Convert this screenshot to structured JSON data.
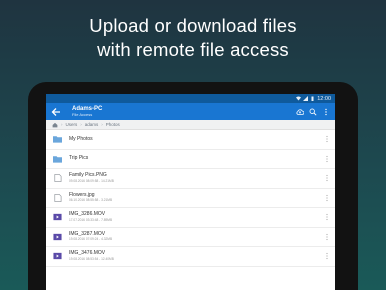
{
  "headline": {
    "line1": "Upload or download files",
    "line2": "with remote file access"
  },
  "status_bar": {
    "time": "12:00"
  },
  "app_bar": {
    "title": "Adams-PC",
    "subtitle": "File Access"
  },
  "breadcrumb": [
    "Users",
    "adams",
    "Photos"
  ],
  "files": [
    {
      "name": "My Photos",
      "meta": "",
      "type": "folder"
    },
    {
      "name": "Trip Pics",
      "meta": "",
      "type": "folder"
    },
    {
      "name": "Family Pics.PNG",
      "meta": "09.08.2016 08:09:58 - 14.21MB",
      "type": "file"
    },
    {
      "name": "Flowers.jpg",
      "meta": "06.10.2016 08:55:58 - 3.21MB",
      "type": "file"
    },
    {
      "name": "IMG_3286.MOV",
      "meta": "17.07.2016 03:33:48 - 7.89MB",
      "type": "video"
    },
    {
      "name": "IMG_3287.MOV",
      "meta": "19.08.2016 07:09:24 - 4.32MB",
      "type": "video"
    },
    {
      "name": "IMG_3476.MOV",
      "meta": "19.08.2016 08:53:54 - 12.40MB",
      "type": "video"
    }
  ],
  "colors": {
    "app_bar": "#1976d2",
    "status_bar": "#0f5a9c",
    "folder_icon": "#5b9bd5",
    "video_icon": "#5a4aa8"
  }
}
